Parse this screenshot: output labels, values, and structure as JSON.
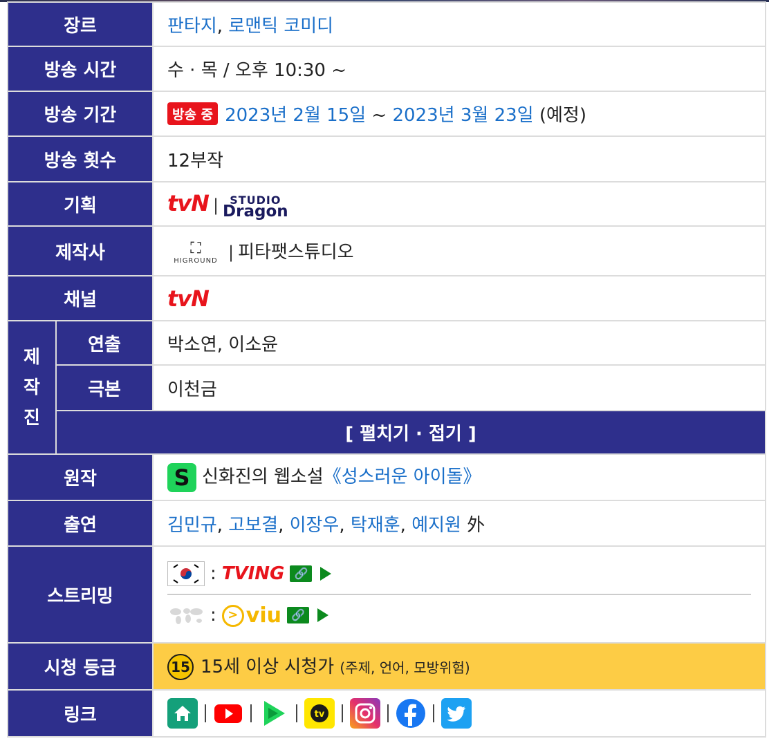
{
  "rows": {
    "genre": {
      "label": "장르",
      "value1": "판타지",
      "comma": ", ",
      "value2": "로맨틱 코미디"
    },
    "airtime": {
      "label": "방송 시간",
      "value": "수 · 목 / 오후 10:30 ~"
    },
    "period": {
      "label": "방송 기간",
      "badge": "방송 중",
      "start": "2023년 2월 15일",
      "tilde": " ~ ",
      "end": "2023년 3월 23일",
      "note": " (예정)"
    },
    "episodes": {
      "label": "방송 횟수",
      "value": "12부작"
    },
    "planning": {
      "label": "기획",
      "tvn": "tvN",
      "sep": "|",
      "studio1": "STUDIO",
      "studio2": "Dragon"
    },
    "producer": {
      "label": "제작사",
      "logo_mark": "⛶",
      "logo_text": "HIGROUND",
      "sep": "|",
      "value": "피타팻스튜디오"
    },
    "channel": {
      "label": "채널",
      "tvn": "tvN"
    },
    "crew": {
      "group_label": [
        "제",
        "작",
        "진"
      ],
      "director": {
        "label": "연출",
        "value": "박소연, 이소윤"
      },
      "writer": {
        "label": "극본",
        "value": "이천금"
      },
      "toggle": "[ 펼치기 · 접기 ]"
    },
    "original": {
      "label": "원작",
      "icon_letter": "S",
      "prefix": "신화진의 웹소설",
      "lq": "《",
      "title": "성스러운 아이돌",
      "rq": "》"
    },
    "cast": {
      "label": "출연",
      "names": [
        "김민규",
        "고보결",
        "이장우",
        "탁재훈",
        "예지원"
      ],
      "comma": ", ",
      "suffix": " 外"
    },
    "streaming": {
      "label": "스트리밍",
      "colon": ":",
      "kr_service": "TVING",
      "global_service": "viu",
      "viu_glyph": ">",
      "link_glyph": "🔗"
    },
    "rating": {
      "label": "시청 등급",
      "age": "15",
      "value": "15세 이상 시청가",
      "detail": "(주제, 언어, 모방위험)"
    },
    "links": {
      "label": "링크",
      "sep": "|"
    }
  },
  "colors": {
    "header_bg": "#2e2f8c",
    "link_blue": "#1a6fc9",
    "tvn_red": "#e8141c",
    "rating_bg": "#fdcc45",
    "studio_navy": "#1a1a5e"
  },
  "icons": [
    "home-icon",
    "youtube-icon",
    "tving-play-icon",
    "kakaotv-icon",
    "instagram-icon",
    "facebook-icon",
    "twitter-icon"
  ]
}
